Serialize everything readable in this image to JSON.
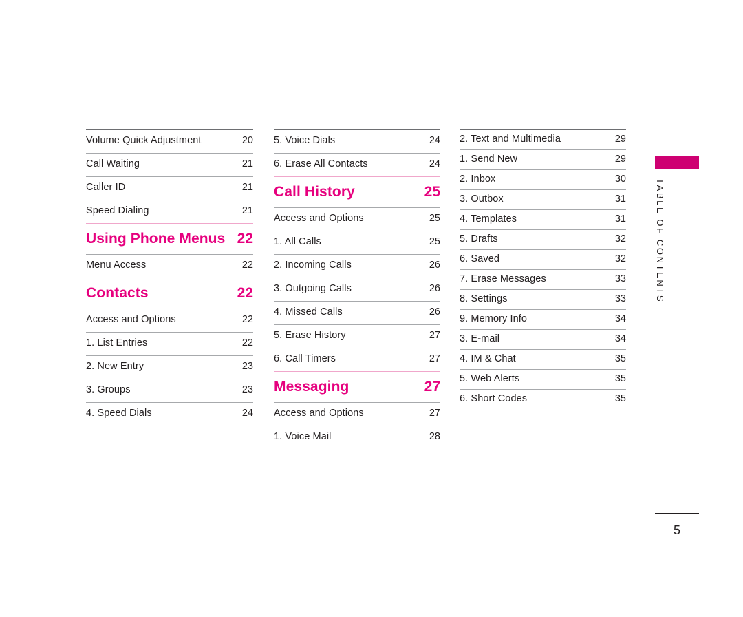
{
  "document": {
    "page_number": "5",
    "side_tab_label": "TABLE OF CONTENTS",
    "accent_color": "#e6007e",
    "tab_bar_color": "#ce0072"
  },
  "columns": [
    {
      "id": "column-1",
      "entries": [
        {
          "type": "entry",
          "label": "Volume Quick Adjustment",
          "page": "20"
        },
        {
          "type": "entry",
          "label": "Call Waiting",
          "page": "21"
        },
        {
          "type": "entry",
          "label": "Caller ID",
          "page": "21"
        },
        {
          "type": "entry",
          "label": "Speed Dialing",
          "page": "21"
        },
        {
          "type": "section",
          "label": "Using Phone Menus",
          "page": "22"
        },
        {
          "type": "entry",
          "label": "Menu Access",
          "page": "22"
        },
        {
          "type": "section",
          "label": "Contacts",
          "page": "22"
        },
        {
          "type": "entry",
          "label": "Access and Options",
          "page": "22"
        },
        {
          "type": "entry",
          "label": "1. List Entries",
          "page": "22"
        },
        {
          "type": "entry",
          "label": "2. New Entry",
          "page": "23"
        },
        {
          "type": "entry",
          "label": "3. Groups",
          "page": "23"
        },
        {
          "type": "entry",
          "label": "4. Speed Dials",
          "page": "24"
        }
      ]
    },
    {
      "id": "column-2",
      "entries": [
        {
          "type": "entry",
          "label": "5. Voice Dials",
          "page": "24"
        },
        {
          "type": "entry",
          "label": "6. Erase All Contacts",
          "page": "24"
        },
        {
          "type": "section",
          "label": "Call History",
          "page": "25"
        },
        {
          "type": "entry",
          "label": "Access and Options",
          "page": "25"
        },
        {
          "type": "entry",
          "label": "1. All Calls",
          "page": "25"
        },
        {
          "type": "entry",
          "label": "2. Incoming Calls",
          "page": "26"
        },
        {
          "type": "entry",
          "label": "3. Outgoing Calls",
          "page": "26"
        },
        {
          "type": "entry",
          "label": "4. Missed Calls",
          "page": "26"
        },
        {
          "type": "entry",
          "label": "5. Erase History",
          "page": "27"
        },
        {
          "type": "entry",
          "label": "6. Call Timers",
          "page": "27"
        },
        {
          "type": "section",
          "label": "Messaging",
          "page": "27"
        },
        {
          "type": "entry",
          "label": "Access and Options",
          "page": "27"
        },
        {
          "type": "entry",
          "label": "1. Voice Mail",
          "page": "28"
        }
      ]
    },
    {
      "id": "column-3",
      "entries": [
        {
          "type": "entry",
          "label": "2. Text and Multimedia",
          "page": "29"
        },
        {
          "type": "entry",
          "label": "1. Send New",
          "page": "29"
        },
        {
          "type": "entry",
          "label": "2. Inbox",
          "page": "30"
        },
        {
          "type": "entry",
          "label": "3. Outbox",
          "page": "31"
        },
        {
          "type": "entry",
          "label": "4. Templates",
          "page": "31"
        },
        {
          "type": "entry",
          "label": "5. Drafts",
          "page": "32"
        },
        {
          "type": "entry",
          "label": "6. Saved",
          "page": "32"
        },
        {
          "type": "entry",
          "label": "7. Erase Messages",
          "page": "33"
        },
        {
          "type": "entry",
          "label": "8. Settings",
          "page": "33"
        },
        {
          "type": "entry",
          "label": "9. Memory Info",
          "page": "34"
        },
        {
          "type": "entry",
          "label": "3. E-mail",
          "page": "34"
        },
        {
          "type": "entry",
          "label": "4. IM & Chat",
          "page": "35"
        },
        {
          "type": "entry",
          "label": "5. Web Alerts",
          "page": "35"
        },
        {
          "type": "entry",
          "label": "6. Short Codes",
          "page": "35"
        }
      ]
    }
  ]
}
